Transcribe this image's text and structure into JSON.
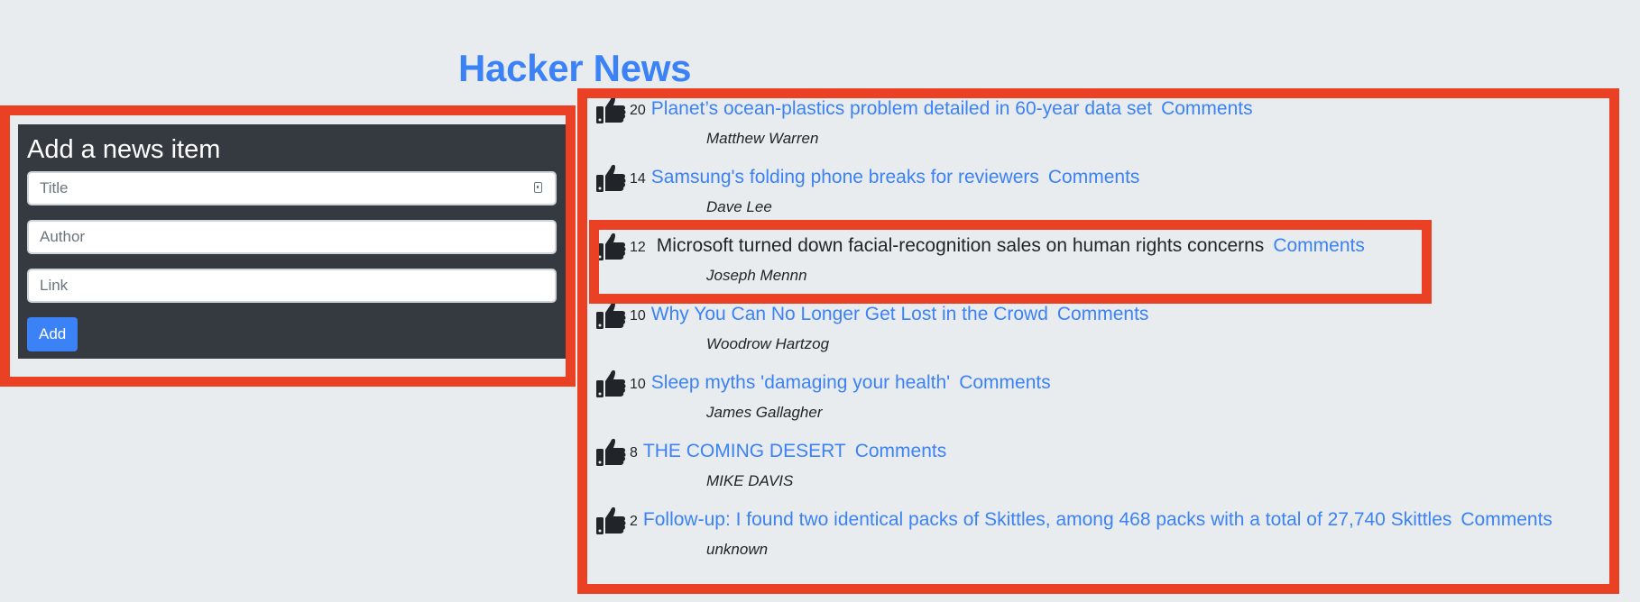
{
  "header": {
    "title": "Hacker News"
  },
  "form": {
    "heading": "Add a news item",
    "title_placeholder": "Title",
    "author_placeholder": "Author",
    "link_placeholder": "Link",
    "add_label": "Add"
  },
  "news": [
    {
      "votes": "20",
      "title": "Planet’s ocean-plastics problem detailed in 60-year data set",
      "comments": "Comments",
      "author": "Matthew Warren"
    },
    {
      "votes": "14",
      "title": "Samsung's folding phone breaks for reviewers",
      "comments": "Comments",
      "author": "Dave Lee"
    },
    {
      "votes": "12",
      "title": "Microsoft turned down facial-recognition sales on human rights concerns",
      "comments": "Comments",
      "author": "Joseph Mennn"
    },
    {
      "votes": "10",
      "title": "Why You Can No Longer Get Lost in the Crowd",
      "comments": "Comments",
      "author": "Woodrow Hartzog"
    },
    {
      "votes": "10",
      "title": "Sleep myths 'damaging your health'",
      "comments": "Comments",
      "author": "James Gallagher"
    },
    {
      "votes": "8",
      "title": "THE COMING DESERT",
      "comments": "Comments",
      "author": "MIKE DAVIS"
    },
    {
      "votes": "2",
      "title": "Follow-up: I found two identical packs of Skittles, among 468 packs with a total of 27,740 Skittles",
      "comments": "Comments",
      "author": "unknown"
    }
  ],
  "colors": {
    "accent": "#3b82f6",
    "panel": "#343a40",
    "annotation": "#ea4125",
    "background": "#e9ecef"
  }
}
